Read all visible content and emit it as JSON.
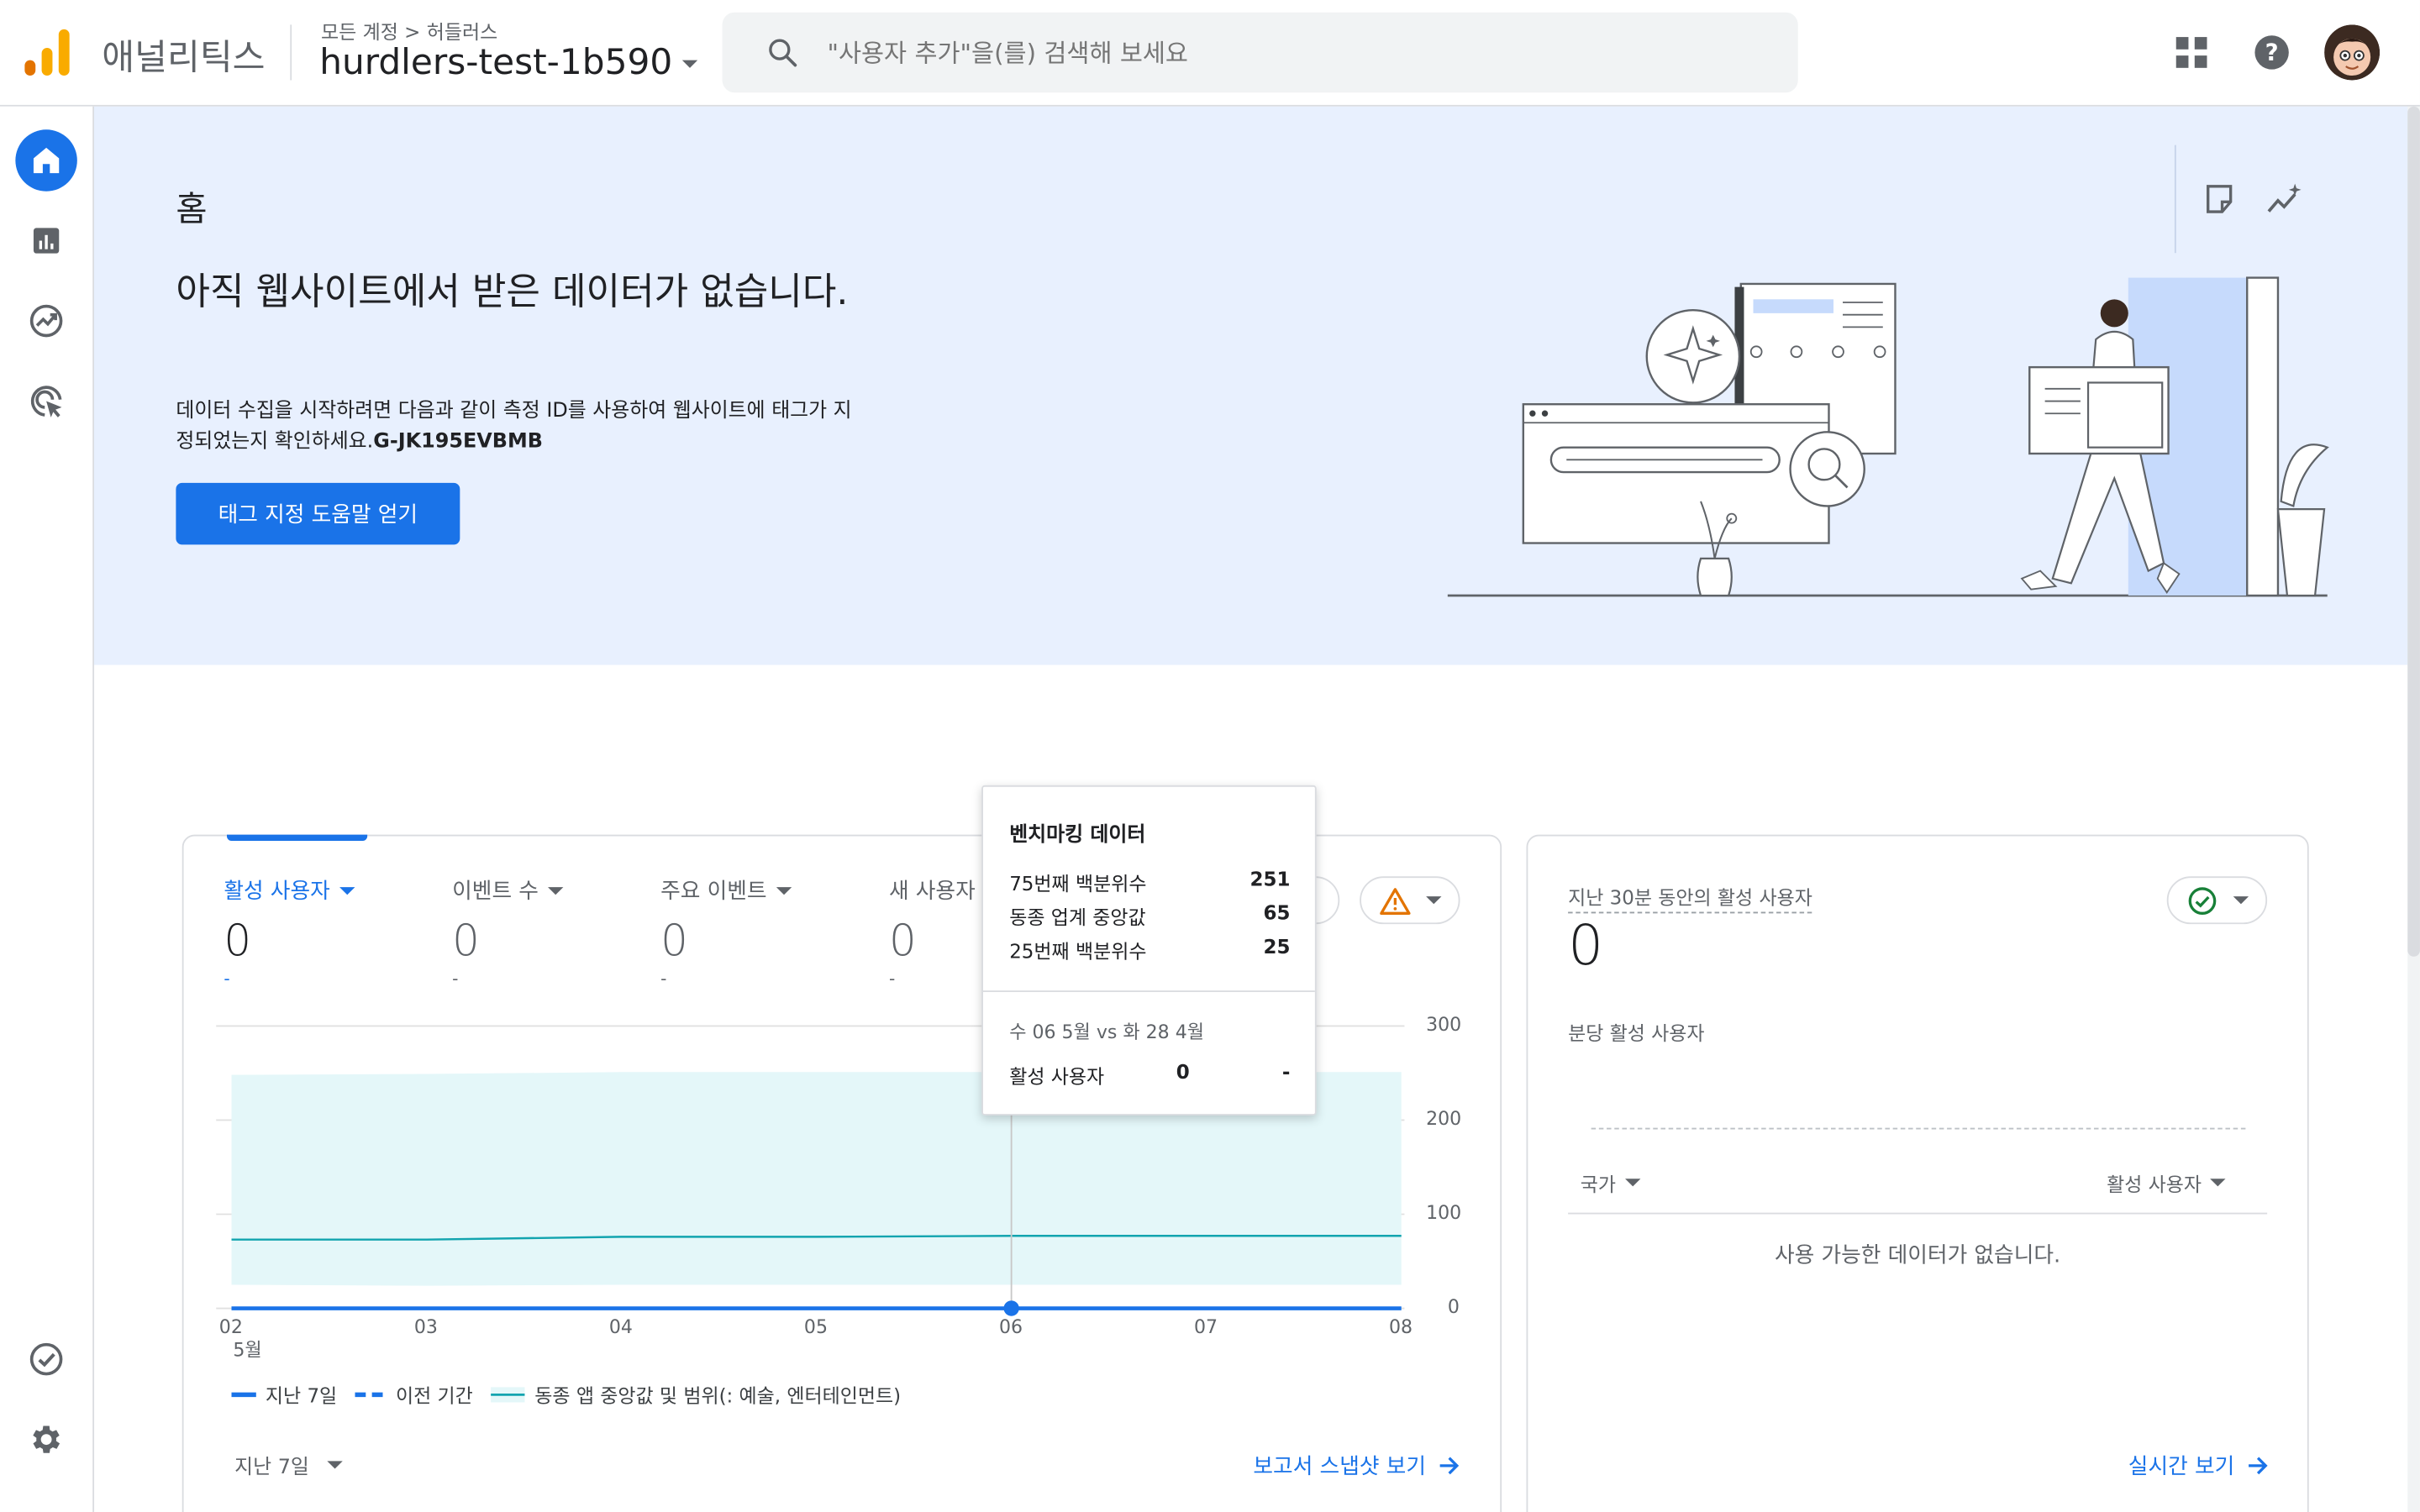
{
  "header": {
    "app_name": "애널리틱스",
    "breadcrumb": [
      "모든 계정",
      "허들러스"
    ],
    "property": "hurdlers-test-1b590",
    "search_placeholder": "\"사용자 추가\"을(를) 검색해 보세요"
  },
  "hero": {
    "title": "홈",
    "heading": "아직 웹사이트에서 받은 데이터가 없습니다.",
    "desc": "데이터 수집을 시작하려면 다음과 같이 측정 ID를 사용하여 웹사이트에 태그가 지정되었는지 확인하세요.",
    "measurement_id": "G-JK195EVBMB",
    "button": "태그 지정 도움말 얻기"
  },
  "overview": {
    "metrics": [
      {
        "label": "활성 사용자",
        "value": "0",
        "change": "-"
      },
      {
        "label": "이벤트 수",
        "value": "0",
        "change": "-"
      },
      {
        "label": "주요 이벤트",
        "value": "0",
        "change": "-"
      },
      {
        "label": "새 사용자",
        "value": "0",
        "change": "-"
      }
    ],
    "legend": [
      "지난 7일",
      "이전 기간",
      "동종 앱 중앙값 및 범위(: 예술, 엔터테인먼트)"
    ],
    "range": "지난 7일",
    "link": "보고서 스냅샷 보기",
    "month_label": "5월"
  },
  "tooltip": {
    "title": "벤치마킹 데이터",
    "rows": [
      {
        "label": "75번째 백분위수",
        "value": "251"
      },
      {
        "label": "동종 업계 중앙값",
        "value": "65"
      },
      {
        "label": "25번째 백분위수",
        "value": "25"
      }
    ],
    "date": "수 06 5월 vs 화 28 4월",
    "metric_label": "활성 사용자",
    "metric_value": "0",
    "metric_prev": "-"
  },
  "chart_data": {
    "type": "area",
    "x": [
      "02",
      "03",
      "04",
      "05",
      "06",
      "07",
      "08"
    ],
    "yticks": [
      0,
      100,
      200,
      300
    ],
    "ylim": [
      0,
      300
    ],
    "series": [
      {
        "name": "지난 7일",
        "values": [
          0,
          0,
          0,
          0,
          0,
          0,
          0
        ]
      },
      {
        "name": "이전 기간",
        "values": [
          0,
          0,
          0,
          0,
          0,
          0,
          0
        ]
      },
      {
        "name": "동종 앱 중앙값 및 범위(: 예술, 엔터테인먼트)",
        "median": [
          73,
          73,
          76,
          76,
          77,
          77,
          77
        ],
        "p75": [
          248,
          249,
          251,
          251,
          251,
          251,
          251
        ],
        "p25": [
          25,
          24,
          25,
          25,
          25,
          25,
          25
        ]
      }
    ],
    "colors": {
      "last7": "#1a73e8",
      "benchmark_line": "#12a4af",
      "benchmark_band": "#e4f7f9"
    }
  },
  "realtime": {
    "label": "지난 30분 동안의 활성 사용자",
    "value": "0",
    "sub": "분당 활성 사용자",
    "col1": "국가",
    "col2": "활성 사용자",
    "empty": "사용 가능한 데이터가 없습니다.",
    "link": "실시간 보기"
  }
}
